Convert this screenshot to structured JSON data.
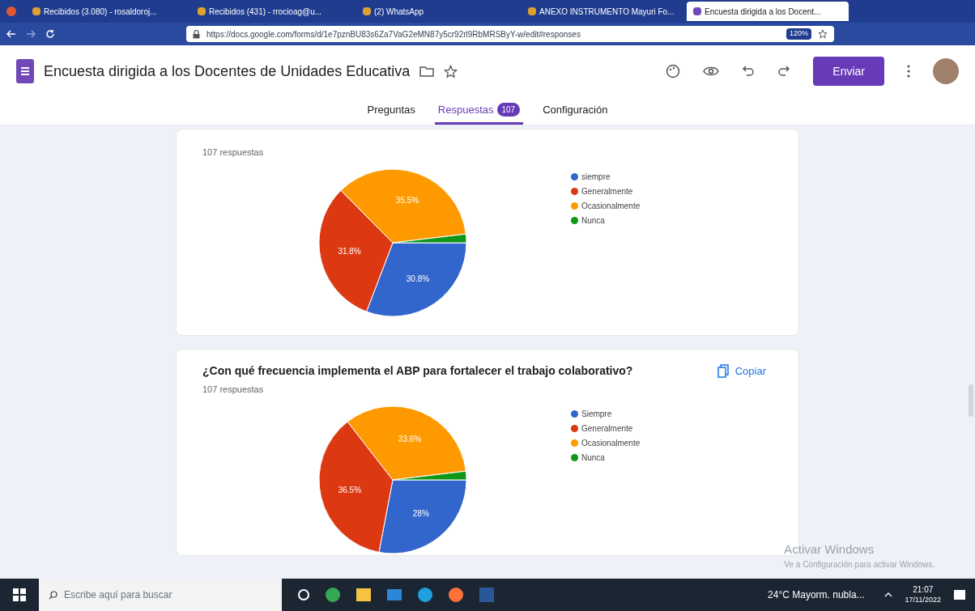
{
  "browser": {
    "tabs": [
      {
        "label": "Recibidos (3.080) - rosaldoroj...",
        "selected": false
      },
      {
        "label": "Recibidos (431) - rrocioag@u...",
        "selected": false
      },
      {
        "label": "(2) WhatsApp",
        "selected": false
      },
      {
        "label": "ANEXO INSTRUMENTO Mayuri Fo...",
        "selected": false
      },
      {
        "label": "Encuesta dirigida a los Docent...",
        "selected": true
      }
    ],
    "url": "https://docs.google.com/forms/d/1e7pznBU83s6Za7VaG2eMN87y5cr92rl9RbMRSByY-w/edit#responses",
    "zoom": "120%"
  },
  "form": {
    "title": "Encuesta dirigida a los Docentes de Unidades Educativa",
    "send_button": "Enviar",
    "tabs": [
      {
        "label": "Preguntas",
        "selected": false
      },
      {
        "label": "Respuestas",
        "selected": true,
        "badge": "107"
      },
      {
        "label": "Configuración",
        "selected": false
      }
    ]
  },
  "cards": [
    {
      "responses": "107 respuestas",
      "chart_data": {
        "type": "pie",
        "categories": [
          "siempre",
          "Generalmente",
          "Ocasionalmente",
          "Nunca"
        ],
        "values": [
          30.8,
          31.8,
          35.5,
          1.9
        ],
        "colors": [
          "#3366cc",
          "#dc3912",
          "#ff9900",
          "#109618"
        ],
        "value_labels": [
          "30.8%",
          "31.8%",
          "35.5%",
          null
        ]
      }
    },
    {
      "question": "¿Con qué frecuencia implementa el ABP para fortalecer el trabajo colaborativo?",
      "copy_button": "Copiar",
      "responses": "107 respuestas",
      "chart_data": {
        "type": "pie",
        "categories": [
          "Siempre",
          "Generalmente",
          "Ocasionalmente",
          "Nunca"
        ],
        "values": [
          28,
          36.5,
          33.6,
          1.9
        ],
        "colors": [
          "#3366cc",
          "#dc3912",
          "#ff9900",
          "#109618"
        ],
        "value_labels": [
          "28%",
          "36.5%",
          "33.6%",
          null
        ]
      }
    }
  ],
  "activation_notice": {
    "title": "Activar Windows",
    "text": "Ve a Configuración para activar Windows."
  },
  "taskbar": {
    "search_placeholder": "Escribe aquí para buscar",
    "weather": "24°C Mayorm. nubla...",
    "time": "21:07",
    "date": "17/11/2022"
  }
}
